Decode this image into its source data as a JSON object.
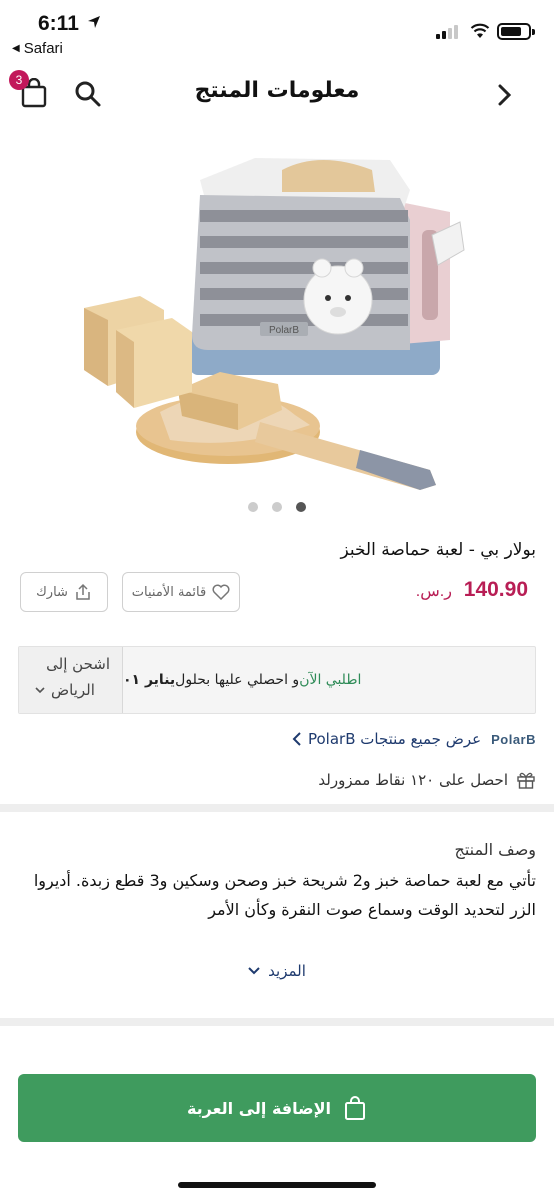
{
  "status_bar": {
    "time": "6:11",
    "back_app": "Safari"
  },
  "header": {
    "title": "معلومات المنتج",
    "cart_count": "3"
  },
  "product": {
    "name": "بولار بي - لعبة حماصة الخبز",
    "price": "140.90",
    "currency": "ر.س.",
    "image_pages": 3,
    "active_image_index": 2,
    "image_label_text": "PolarB"
  },
  "actions": {
    "wishlist_label": "قائمة الأمنيات",
    "share_label": "شارك"
  },
  "shipping": {
    "ship_to_label": "اشحن إلى",
    "city": "الرياض",
    "order_now": "اطلبي الآن",
    "delivery_text": " و احصلي عليها بحلول ",
    "delivery_date": "يناير ٠١"
  },
  "brand": {
    "logo_text": "PolarB",
    "link_label": "عرض جميع منتجات PolarB"
  },
  "points": {
    "label": "احصل على ١٢٠ نقاط ممزورلد"
  },
  "description": {
    "title": "وصف المنتج",
    "text": "تأتي مع لعبة حماصة خبز و2 شريحة خبز وصحن وسكين و3 قطع زبدة. أديروا الزر لتحديد الوقت وسماع صوت النقرة وكأن الأمر",
    "more_label": "المزيد"
  },
  "cart_button": {
    "label": "الإضافة إلى العربة"
  },
  "colors": {
    "price": "#b81e55",
    "cart_button": "#3f9b5e",
    "link": "#1e3a6e",
    "badge": "#c2185b"
  }
}
